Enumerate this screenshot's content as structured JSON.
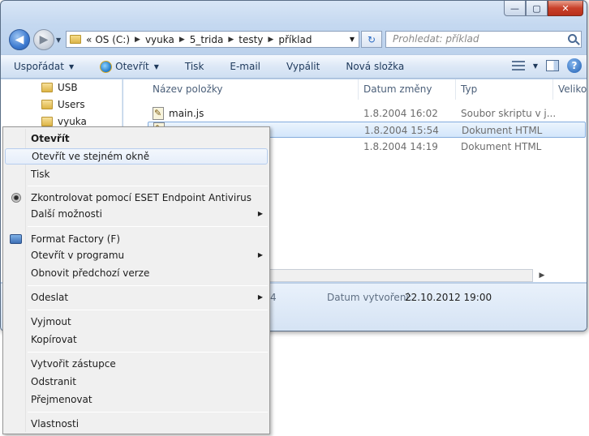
{
  "window": {
    "minimize_glyph": "—",
    "maximize_glyph": "▢",
    "close_glyph": "✕"
  },
  "nav": {
    "back_glyph": "◀",
    "forward_glyph": "▶"
  },
  "address": {
    "overflow": "«",
    "crumbs": [
      "OS (C:)",
      "vyuka",
      "5_trida",
      "testy",
      "příklad"
    ],
    "separator": "▶",
    "dropdown": "▼"
  },
  "refresh_glyph": "↻",
  "search": {
    "placeholder": "Prohledat: příklad"
  },
  "toolbar": {
    "organize": "Uspořádat",
    "open": "Otevřít",
    "print": "Tisk",
    "email": "E-mail",
    "burn": "Vypálit",
    "new_folder": "Nová složka",
    "help": "?",
    "arrow": "▼"
  },
  "navpane": {
    "items": [
      "USB",
      "Users",
      "vyuka"
    ]
  },
  "columns": {
    "name": "Název položky",
    "date": "Datum změny",
    "type": "Typ",
    "size": "Velikost"
  },
  "sort_glyph": "▲",
  "files": [
    {
      "name": "main.js",
      "date": "1.8.2004 16:02",
      "type": "Soubor skriptu v j..."
    },
    {
      "name": "",
      "date": "1.8.2004 15:54",
      "type": "Dokument HTML"
    },
    {
      "name": "",
      "date": "1.8.2004 14:19",
      "type": "Dokument HTML"
    }
  ],
  "scroll_arrow": "▶",
  "details": {
    "truncated": "4",
    "created_label": "Datum vytvoření:",
    "created_value": "22.10.2012 19:00"
  },
  "context_menu": {
    "open": "Otevřít",
    "open_same_window": "Otevřít ve stejném okně",
    "print": "Tisk",
    "eset": "Zkontrolovat pomocí ESET Endpoint Antivirus",
    "more_options": "Další možnosti",
    "format_factory": "Format Factory (F)",
    "open_with": "Otevřít v programu",
    "restore": "Obnovit předchozí verze",
    "send_to": "Odeslat",
    "cut": "Vyjmout",
    "copy": "Kopírovat",
    "create_shortcut": "Vytvořit zástupce",
    "delete": "Odstranit",
    "rename": "Přejmenovat",
    "properties": "Vlastnosti",
    "submenu_arrow": "▶"
  }
}
